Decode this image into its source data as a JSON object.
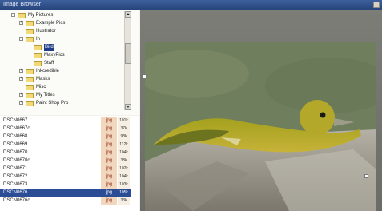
{
  "window": {
    "title": "Image Browser"
  },
  "tree": {
    "items": [
      {
        "label": "My Pictures",
        "expander": "-",
        "level": 0,
        "selected": false
      },
      {
        "label": "Example Pics",
        "expander": "+",
        "level": 1,
        "selected": false
      },
      {
        "label": "Illustrator",
        "expander": "",
        "level": 1,
        "selected": false
      },
      {
        "label": "In",
        "expander": "-",
        "level": 1,
        "selected": false
      },
      {
        "label": "Bird",
        "expander": "",
        "level": 2,
        "selected": true
      },
      {
        "label": "MaxyPics",
        "expander": "",
        "level": 2,
        "selected": false
      },
      {
        "label": "Staff",
        "expander": "",
        "level": 2,
        "selected": false
      },
      {
        "label": "Inkcredible",
        "expander": "+",
        "level": 1,
        "selected": false
      },
      {
        "label": "Masks",
        "expander": "+",
        "level": 1,
        "selected": false
      },
      {
        "label": "Misc",
        "expander": "",
        "level": 1,
        "selected": false
      },
      {
        "label": "My Titles",
        "expander": "+",
        "level": 1,
        "selected": false
      },
      {
        "label": "Paint Shop Pro",
        "expander": "+",
        "level": 1,
        "selected": false
      }
    ]
  },
  "files": {
    "rows": [
      {
        "name": "DSCN0667",
        "type": "jpg",
        "size": "101k",
        "selected": false
      },
      {
        "name": "DSCN0667c",
        "type": "jpg",
        "size": "37k",
        "selected": false
      },
      {
        "name": "DSCN0668",
        "type": "jpg",
        "size": "98k",
        "selected": false
      },
      {
        "name": "DSCN0669",
        "type": "jpg",
        "size": "112k",
        "selected": false
      },
      {
        "name": "DSCN0670",
        "type": "jpg",
        "size": "104k",
        "selected": false
      },
      {
        "name": "DSCN0670c",
        "type": "jpg",
        "size": "38k",
        "selected": false
      },
      {
        "name": "DSCN0671",
        "type": "jpg",
        "size": "102k",
        "selected": false
      },
      {
        "name": "DSCN0672",
        "type": "jpg",
        "size": "104k",
        "selected": false
      },
      {
        "name": "DSCN0673",
        "type": "jpg",
        "size": "103k",
        "selected": false
      },
      {
        "name": "DSCN0676",
        "type": "jpg",
        "size": "105k",
        "selected": true
      },
      {
        "name": "DSCN0676c",
        "type": "jpg",
        "size": "33k",
        "selected": false
      }
    ]
  },
  "colors": {
    "selection": "#2b4d96",
    "type_column": "#f2d7be",
    "preview_background": "#767671"
  }
}
